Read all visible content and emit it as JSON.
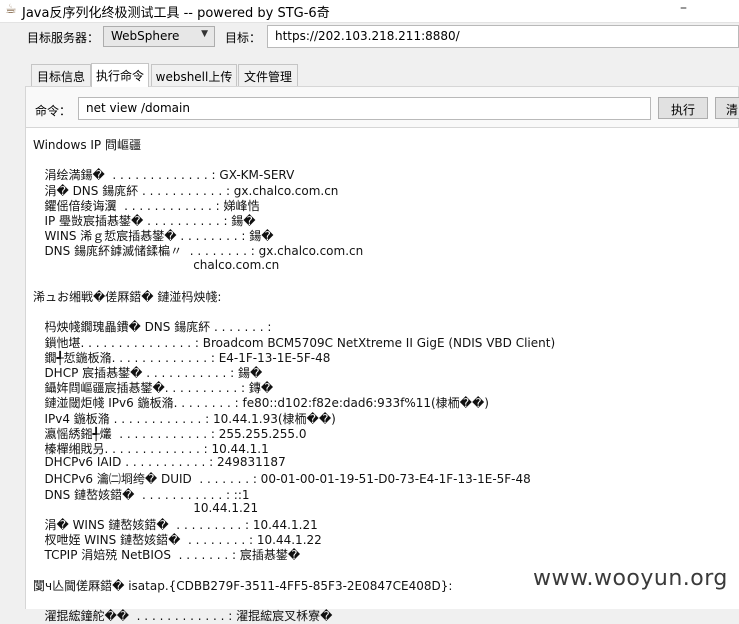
{
  "window": {
    "title": "Java反序列化终极测试工具  -- powered by STG-6奇",
    "control_glyph": "–"
  },
  "target_bar": {
    "server_label": "目标服务器：",
    "server_value": "WebSphere",
    "target_label": "目标：",
    "target_value": "https://202.103.218.211:8880/"
  },
  "tabs": [
    {
      "label": "目标信息"
    },
    {
      "label": "执行命令"
    },
    {
      "label": "webshell上传"
    },
    {
      "label": "文件管理"
    }
  ],
  "command": {
    "label": "命令：",
    "value": "net view /domain",
    "execute_label": "执行",
    "clear_label": "清"
  },
  "output_lines": [
    "Windows IP 閰嶇疆",
    "",
    "   涓绘満鍚�  . . . . . . . . . . . . . : GX-KM-SERV",
    "   涓� DNS 鍚庣紑 . . . . . . . . . . . : gx.chalco.com.cn",
    "   鑺傜偣绫诲瀷  . . . . . . . . . . . . : 娣峰悎",
    "   IP 璺敱宸插惎鐢� . . . . . . . . . . : 鍚�",
    "   WINS 浠ｇ悊宸插惎鐢� . . . . . . . . : 鍚�",
    "   DNS 鍚庣紑鎼滅储鍒楄〃  . . . . . . . . : gx.chalco.com.cn",
    "                                          chalco.com.cn",
    "",
    "浠ュお缃戦�傞厤鍣� 鏈湴杩炴帴:",
    "",
    "   杩炴帴鐗瑰畾鐨� DNS 鍚庣紑 . . . . . . . :",
    "   鎻忚堪. . . . . . . . . . . . . . . : Broadcom BCM5709C NetXtreme II GigE (NDIS VBD Client)",
    "   鐗╃悊鍦板潃. . . . . . . . . . . . . : E4-1F-13-1E-5F-48",
    "   DHCP 宸插惎鐢� . . . . . . . . . . . : 鍚�",
    "   鑷姩閰嶇疆宸插惎鐢�. . . . . . . . . . : 鏄�",
    "   鏈湴閾炬帴 IPv6 鍦板潃. . . . . . . . : fe80::d102:f82e:dad6:933f%11(棣栭��)",
    "   IPv4 鍦板潃 . . . . . . . . . . . . : 10.44.1.93(棣栭��)",
    "   瀛愮綉鎺╃爜  . . . . . . . . . . . . : 255.255.255.0",
    "   榛樿缃戝叧. . . . . . . . . . . . . : 10.44.1.1",
    "   DHCPv6 IAID . . . . . . . . . . . : 249831187",
    "   DHCPv6 瀹㈡埛绔� DUID  . . . . . . . : 00-01-00-01-19-51-D0-73-E4-1F-13-1E-5F-48",
    "   DNS 鏈嶅姟鍣�  . . . . . . . . . . . : ::1",
    "                                          10.44.1.21",
    "   涓� WINS 鏈嶅姟鍣�  . . . . . . . . . : 10.44.1.21",
    "   杈呭姪 WINS 鏈嶅姟鍣�  . . . . . . . . : 10.44.1.22",
    "   TCPIP 涓婄殑 NetBIOS  . . . . . . . : 宸插惎鐢�",
    "",
    "闅ч亾閫傞厤鍣� isatap.{CDBB279F-3511-4FF5-85F3-2E0847CE408D}:",
    "",
    "   濯掍綋鐘舵��  . . . . . . . . . . . . : 濯掍綋宸叉柇寮�"
  ],
  "watermark": "www.wooyun.org"
}
